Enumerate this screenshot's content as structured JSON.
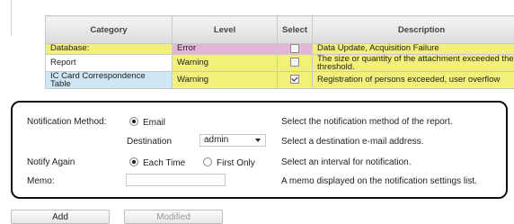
{
  "table": {
    "headers": {
      "category": "Category",
      "level": "Level",
      "select": "Select",
      "description": "Description"
    },
    "rows": [
      {
        "category": "Database:",
        "level": "Error",
        "checked": false,
        "description": "Data Update, Acquisition Failure"
      },
      {
        "category": "Report",
        "level": "Warning",
        "checked": false,
        "description": "The size or quantity of the attachment exceeded the threshold."
      },
      {
        "category": "IC Card Correspondence Table",
        "level": "Warning",
        "checked": true,
        "description": "Registration of persons exceeded, user overflow"
      }
    ]
  },
  "form": {
    "notification_method_label": "Notification Method:",
    "email_option": "Email",
    "notification_method_help": "Select the notification method of the report.",
    "destination_label": "Destination",
    "destination_value": "admin",
    "destination_help": "Select a destination e-mail address.",
    "notify_again_label": "Notify Again",
    "each_time_option": "Each Time",
    "first_only_option": "First Only",
    "notify_again_help": "Select an interval for notification.",
    "memo_label": "Memo:",
    "memo_value": "",
    "memo_help": "A memo displayed on the notification settings list."
  },
  "buttons": {
    "add": "Add",
    "modified": "Modified"
  },
  "colors": {
    "error_row": "#e3b5d6",
    "warning_highlight": "#f2f07a",
    "ic_row": "#cfe6f5",
    "panel_border": "#111111"
  }
}
